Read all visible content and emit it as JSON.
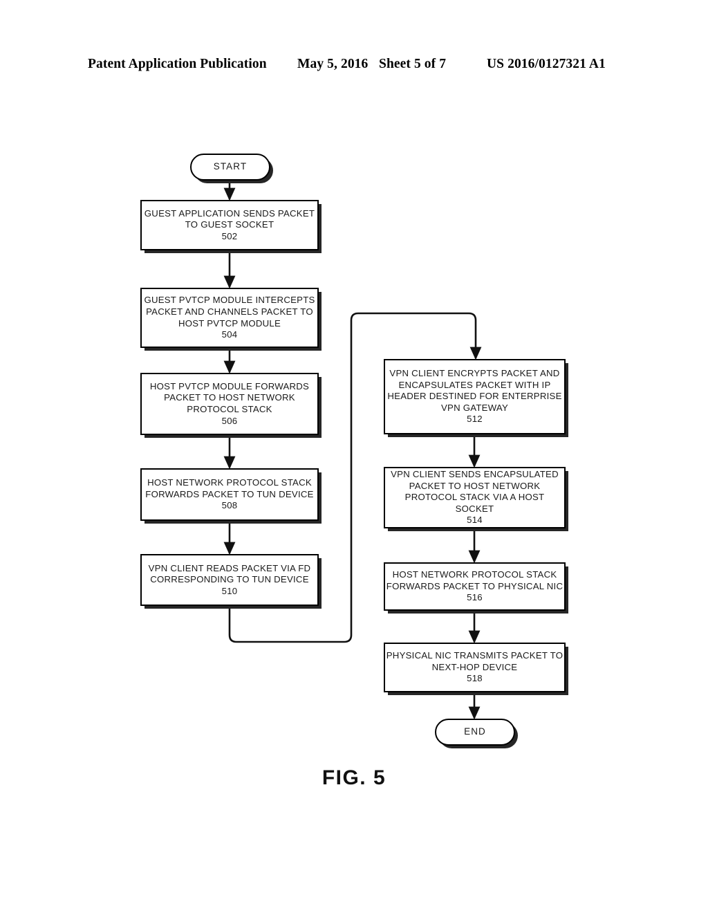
{
  "header": {
    "publication": "Patent Application Publication",
    "date": "May 5, 2016",
    "sheet": "Sheet 5 of 7",
    "patent_number": "US 2016/0127321 A1"
  },
  "figure": {
    "caption": "FIG. 5",
    "start_label": "START",
    "end_label": "END",
    "nodes": [
      {
        "id": "502",
        "ref": "502",
        "lines": [
          "GUEST APPLICATION SENDS PACKET",
          "TO GUEST SOCKET"
        ]
      },
      {
        "id": "504",
        "ref": "504",
        "lines": [
          "GUEST PVTCP MODULE INTERCEPTS",
          "PACKET AND CHANNELS PACKET TO",
          "HOST PVTCP MODULE"
        ]
      },
      {
        "id": "506",
        "ref": "506",
        "lines": [
          "HOST PVTCP MODULE FORWARDS",
          "PACKET TO HOST NETWORK",
          "PROTOCOL STACK"
        ]
      },
      {
        "id": "508",
        "ref": "508",
        "lines": [
          "HOST NETWORK PROTOCOL STACK",
          "FORWARDS PACKET TO TUN DEVICE"
        ]
      },
      {
        "id": "510",
        "ref": "510",
        "lines": [
          "VPN CLIENT READS PACKET VIA FD",
          "CORRESPONDING TO TUN DEVICE"
        ]
      },
      {
        "id": "512",
        "ref": "512",
        "lines": [
          "VPN CLIENT ENCRYPTS PACKET AND",
          "ENCAPSULATES PACKET WITH IP",
          "HEADER DESTINED FOR ENTERPRISE",
          "VPN GATEWAY"
        ]
      },
      {
        "id": "514",
        "ref": "514",
        "lines": [
          "VPN CLIENT SENDS ENCAPSULATED",
          "PACKET TO HOST NETWORK",
          "PROTOCOL STACK VIA A HOST SOCKET"
        ]
      },
      {
        "id": "516",
        "ref": "516",
        "lines": [
          "HOST NETWORK PROTOCOL STACK",
          "FORWARDS PACKET TO PHYSICAL NIC"
        ]
      },
      {
        "id": "518",
        "ref": "518",
        "lines": [
          "PHYSICAL NIC TRANSMITS PACKET TO",
          "NEXT-HOP DEVICE"
        ]
      }
    ]
  },
  "colors": {
    "ink": "#000000",
    "paper": "#ffffff",
    "shadow": "#262626"
  }
}
